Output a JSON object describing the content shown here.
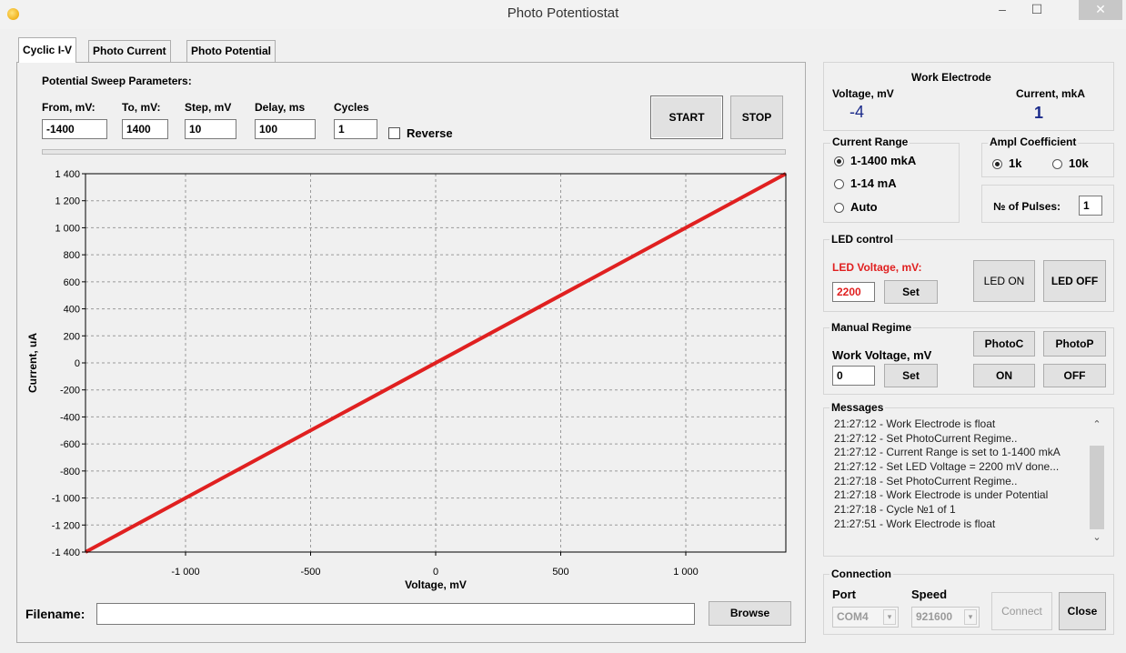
{
  "window": {
    "title": "Photo Potentiostat",
    "min": "–",
    "max": "☐",
    "close": "✕"
  },
  "tabs": [
    "Cyclic I-V",
    "Photo Current",
    "Photo Potential"
  ],
  "sweep": {
    "title": "Potential Sweep Parameters:",
    "from_label": "From, mV:",
    "from_value": "-1400",
    "to_label": "To, mV:",
    "to_value": "1400",
    "step_label": "Step, mV",
    "step_value": "10",
    "delay_label": "Delay, ms",
    "delay_value": "100",
    "cycles_label": "Cycles",
    "cycles_value": "1",
    "reverse_label": "Reverse",
    "reverse_checked": false
  },
  "controls": {
    "start": "START",
    "stop": "STOP"
  },
  "chart_data": {
    "type": "line",
    "xlabel": "Voltage, mV",
    "ylabel": "Current, uA",
    "xlim": [
      -1400,
      1400
    ],
    "ylim": [
      -1400,
      1400
    ],
    "x_ticks": [
      -1000,
      -500,
      0,
      500,
      1000
    ],
    "x_tick_labels": [
      "-1 000",
      "-500",
      "0",
      "500",
      "1 000"
    ],
    "y_ticks": [
      1400,
      1200,
      1000,
      800,
      600,
      400,
      200,
      0,
      -200,
      -400,
      -600,
      -800,
      -1000,
      -1200,
      -1400
    ],
    "y_tick_labels": [
      "1 400",
      "1 200",
      "1 000",
      "800",
      "600",
      "400",
      "200",
      "0",
      "-200",
      "-400",
      "-600",
      "-800",
      "-1 000",
      "-1 200",
      "-1 400"
    ],
    "grid": true,
    "series": [
      {
        "x": [
          -1400,
          1400
        ],
        "y": [
          -1400,
          1400
        ],
        "color": "#e02020"
      }
    ]
  },
  "file": {
    "label": "Filename:",
    "value": "",
    "browse": "Browse"
  },
  "work_electrode": {
    "title": "Work Electrode",
    "voltage_label": "Voltage, mV",
    "voltage_value": "-4",
    "current_label": "Current, mkA",
    "current_value": "1",
    "value_color": "#1a2a8a"
  },
  "current_range": {
    "title": "Current Range",
    "options": [
      "1-1400 mkA",
      "1-14 mA",
      "Auto"
    ],
    "selected": "1-1400 mkA"
  },
  "ampl": {
    "title": "Ampl Coefficient",
    "options": [
      "1k",
      "10k"
    ],
    "selected": "1k"
  },
  "pulses": {
    "label": "№ of Pulses:",
    "value": "1"
  },
  "led": {
    "title": "LED control",
    "voltage_label": "LED Voltage, mV:",
    "voltage_value": "2200",
    "set": "Set",
    "on": "LED ON",
    "off": "LED OFF",
    "accent": "#e02020"
  },
  "manual": {
    "title": "Manual Regime",
    "work_voltage_label": "Work Voltage, mV",
    "work_voltage_value": "0",
    "set": "Set",
    "photoc": "PhotoC",
    "photop": "PhotoP",
    "on": "ON",
    "off": "OFF"
  },
  "messages": {
    "title": "Messages",
    "lines": [
      "21:27:12 - Work Electrode is float",
      "21:27:12 - Set PhotoCurrent Regime..",
      "21:27:12 - Current Range is set to 1-1400 mkA",
      "21:27:12 - Set LED Voltage = 2200 mV done...",
      "21:27:18 - Set PhotoCurrent Regime..",
      "21:27:18 - Work Electrode is under Potential",
      "21:27:18 - Cycle №1 of 1",
      "21:27:51 - Work Electrode is float"
    ]
  },
  "connection": {
    "title": "Connection",
    "port_label": "Port",
    "port_value": "COM4",
    "speed_label": "Speed",
    "speed_value": "921600",
    "connect": "Connect",
    "close": "Close"
  }
}
